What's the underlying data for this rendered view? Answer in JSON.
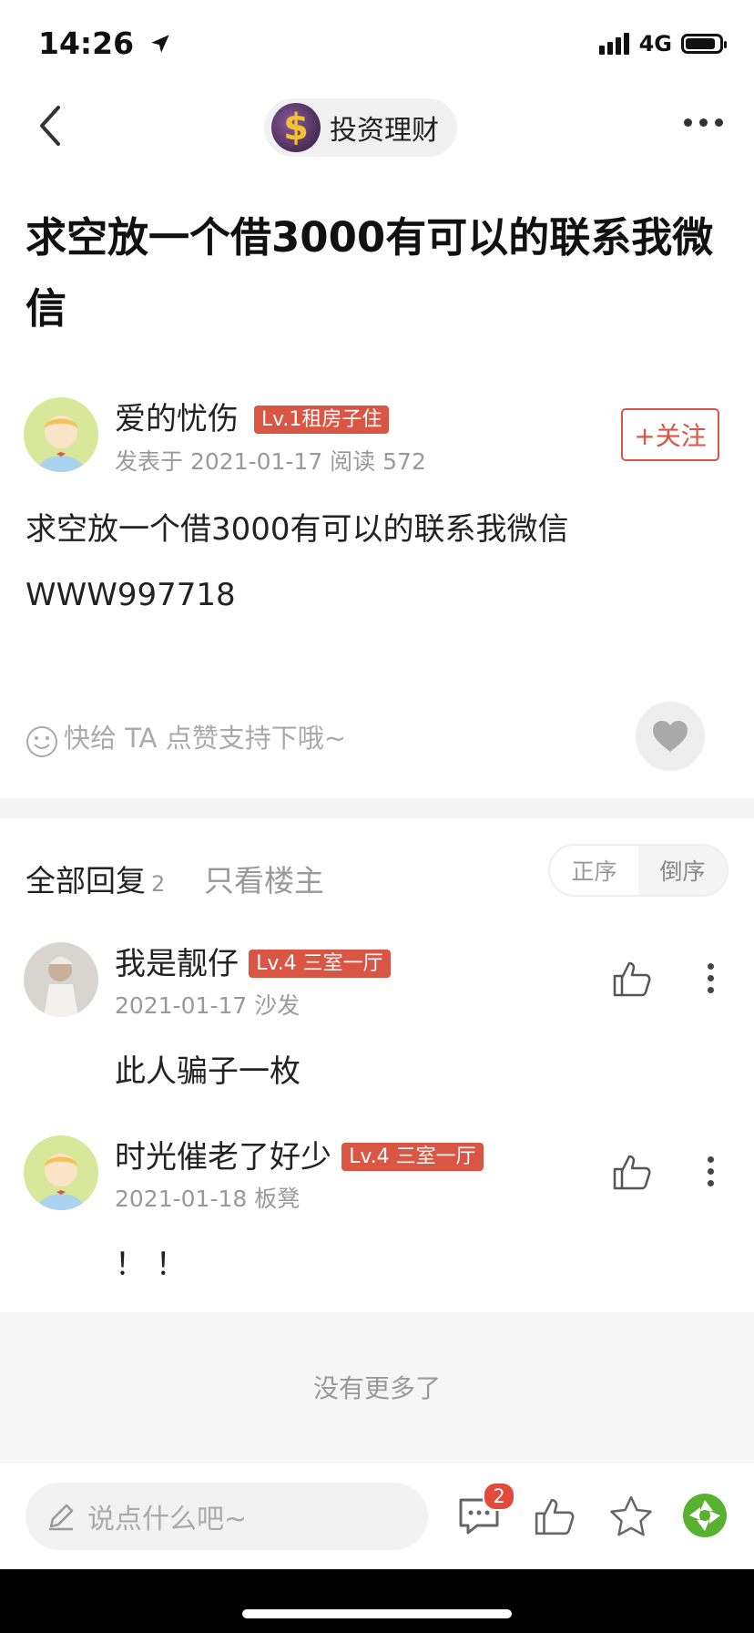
{
  "status": {
    "time": "14:26",
    "network": "4G"
  },
  "nav": {
    "forum_name": "投资理财",
    "forum_icon_symbol": "$"
  },
  "post": {
    "title": "求空放一个借3000有可以的联系我微信",
    "author": {
      "name": "爱的忧伤",
      "badge": "Lv.1租房子住",
      "meta": "发表于 2021-01-17  阅读 572"
    },
    "follow_label": "+关注",
    "content_lines": [
      "求空放一个借3000有可以的联系我微信",
      "WWW997718"
    ],
    "like_hint": "快给 TA 点赞支持下哦~"
  },
  "replies": {
    "header": "全部回复",
    "count": "2",
    "only_op": "只看楼主",
    "order_asc": "正序",
    "order_desc": "倒序",
    "items": [
      {
        "name": "我是靓仔",
        "badge": "Lv.4 三室一厅",
        "meta": "2021-01-17  沙发",
        "text": "此人骗子一枚"
      },
      {
        "name": "时光催老了好少",
        "badge": "Lv.4 三室一厅",
        "meta": "2021-01-18  板凳",
        "text": "！ ！"
      }
    ],
    "no_more": "没有更多了"
  },
  "bottom": {
    "input_placeholder": "说点什么吧~",
    "comment_count": "2"
  },
  "colors": {
    "accent": "#d95645",
    "badge": "#d95645",
    "notif": "#e24a3b"
  }
}
